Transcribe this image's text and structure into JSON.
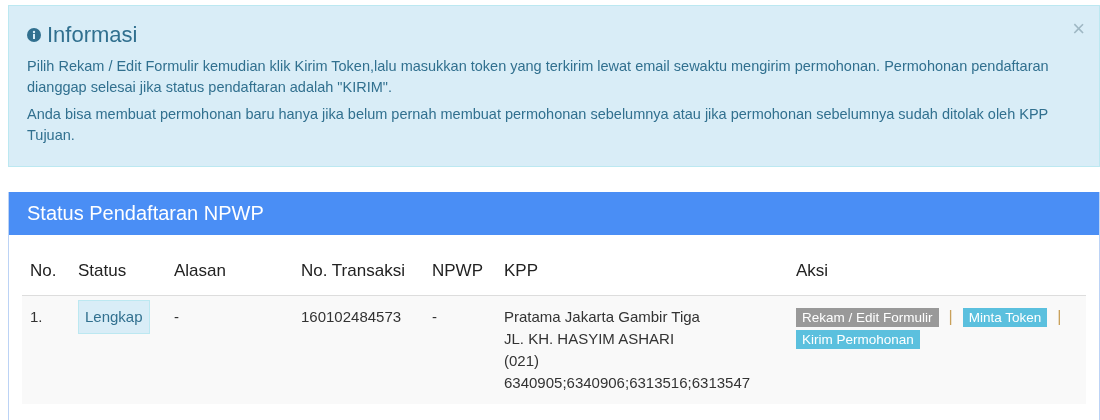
{
  "alert": {
    "title": "Informasi",
    "close": "×",
    "paragraphs": [
      "Pilih Rekam / Edit Formulir kemudian klik Kirim Token,lalu masukkan token yang terkirim lewat email sewaktu mengirim permohonan. Permohonan pendaftaran dianggap selesai jika status pendaftaran adalah \"KIRIM\".",
      "Anda bisa membuat permohonan baru hanya jika belum pernah membuat permohonan sebelumnya atau jika permohonan sebelumnya sudah ditolak oleh KPP Tujuan."
    ]
  },
  "panel": {
    "title": "Status Pendaftaran NPWP",
    "table": {
      "columns": [
        "No.",
        "Status",
        "Alasan",
        "No. Transaksi",
        "NPWP",
        "KPP",
        "Aksi"
      ],
      "rows": [
        {
          "no": "1.",
          "status": "Lengkap",
          "alasan": "-",
          "transaksi": "160102484573",
          "npwp": "-",
          "kpp": [
            "Pratama Jakarta Gambir Tiga",
            "JL. KH. HASYIM ASHARI",
            "(021)",
            "6340905;6340906;6313516;6313547"
          ],
          "actions": [
            {
              "kind": "muted",
              "label": "Rekam / Edit Formulir"
            },
            {
              "kind": "separator",
              "label": "|"
            },
            {
              "kind": "info",
              "label": "Minta Token"
            },
            {
              "kind": "separator",
              "label": "|"
            },
            {
              "kind": "info",
              "label": "Kirim Permohonan"
            }
          ]
        }
      ]
    }
  }
}
